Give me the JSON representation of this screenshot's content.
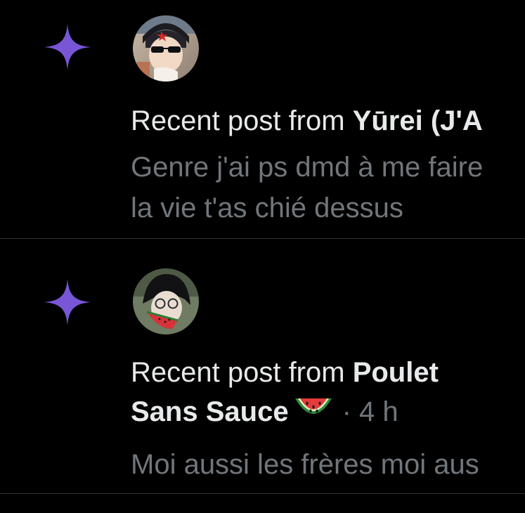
{
  "colors": {
    "background": "#000000",
    "primary_text": "#e7e9ea",
    "secondary_text": "#71767b",
    "divider": "#2f3336",
    "sparkle": "#7856d6"
  },
  "notifications": [
    {
      "icon": "sparkle-icon",
      "prefix": "Recent post from ",
      "author": "Yūrei (J'A",
      "preview_lines": [
        "Genre j'ai ps dmd à me faire",
        "la vie t'as chié dessus"
      ]
    },
    {
      "icon": "sparkle-icon",
      "prefix": "Recent post from ",
      "author": "Poulet Sans Sauce",
      "author_emoji": "watermelon-icon",
      "timestamp": "· 4 h",
      "preview_lines": [
        "Moi aussi les frères moi aus"
      ]
    }
  ]
}
